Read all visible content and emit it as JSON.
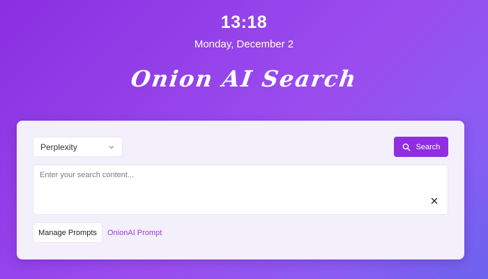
{
  "header": {
    "time": "13:18",
    "date": "Monday, December 2",
    "brand": "Onion AI Search"
  },
  "search": {
    "engine": "Perplexity",
    "button_label": "Search",
    "placeholder": "Enter your search content...",
    "value": ""
  },
  "footer": {
    "manage_prompts_label": "Manage Prompts",
    "prompt_link_label": "OnionAI Prompt"
  },
  "colors": {
    "accent": "#8f2fe0",
    "link": "#9a3ed6",
    "panel": "#f3effb"
  },
  "icons": {
    "select_chevron": "chevron-down-icon",
    "search_button": "search-icon",
    "clear": "close-icon"
  }
}
